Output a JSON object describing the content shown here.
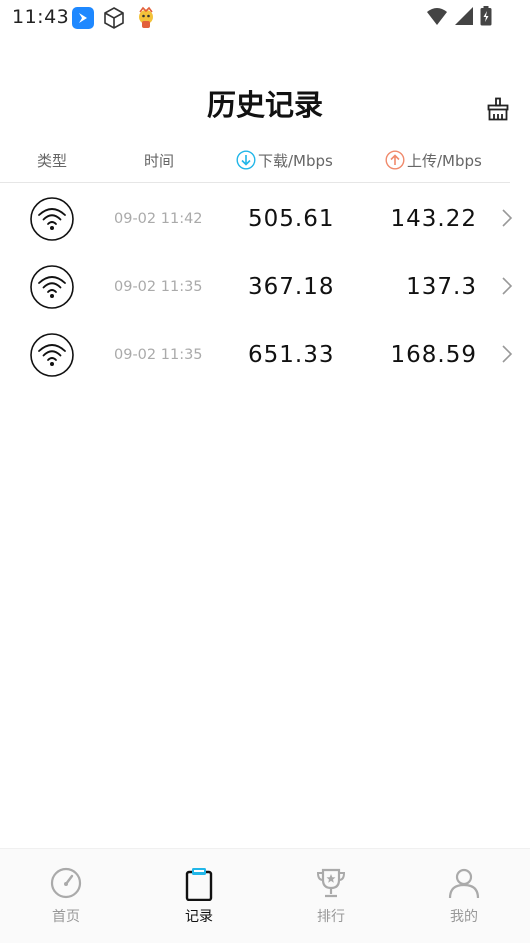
{
  "status_bar": {
    "time": "11:43",
    "left_icons": [
      "app-badge-icon",
      "cube-icon",
      "mascot-icon"
    ],
    "right_icons": [
      "wifi-icon",
      "cellular-signal-icon",
      "battery-icon"
    ]
  },
  "header": {
    "title": "历史记录",
    "clear_icon": "broom-icon"
  },
  "columns": {
    "type": "类型",
    "time": "时间",
    "download": "下载/Mbps",
    "upload": "上传/Mbps",
    "download_icon_color": "#21b6e8",
    "upload_icon_color": "#f08a6c"
  },
  "records": [
    {
      "icon": "wifi-icon",
      "time": "09-02 11:42",
      "download": "505.61",
      "upload": "143.22"
    },
    {
      "icon": "wifi-icon",
      "time": "09-02 11:35",
      "download": "367.18",
      "upload": "137.3"
    },
    {
      "icon": "wifi-icon",
      "time": "09-02 11:35",
      "download": "651.33",
      "upload": "168.59"
    }
  ],
  "tab_bar": {
    "tabs": [
      {
        "label": "首页",
        "icon": "speedometer-icon",
        "active": false
      },
      {
        "label": "记录",
        "icon": "clipboard-icon",
        "active": true
      },
      {
        "label": "排行",
        "icon": "trophy-icon",
        "active": false
      },
      {
        "label": "我的",
        "icon": "user-icon",
        "active": false
      }
    ],
    "accent_color": "#21b6e8"
  }
}
